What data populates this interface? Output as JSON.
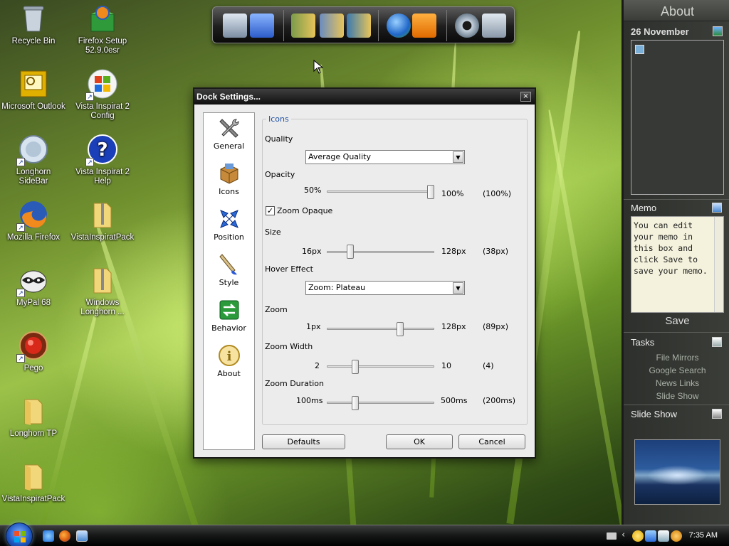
{
  "desktop_icons": [
    {
      "label": "Recycle Bin"
    },
    {
      "label": "Firefox Setup 52.9.0esr"
    },
    {
      "label": "Microsoft Outlook"
    },
    {
      "label": "Vista Inspirat 2 Config"
    },
    {
      "label": "Longhorn SideBar"
    },
    {
      "label": "Vista Inspirat 2 Help"
    },
    {
      "label": "Mozilla Firefox"
    },
    {
      "label": "VistaInspiratPack"
    },
    {
      "label": "MyPal 68"
    },
    {
      "label": "Windows Longhorn ..."
    },
    {
      "label": "Pego"
    },
    {
      "label": "Longhorn TP"
    },
    {
      "label": "VistaInspiratPack"
    }
  ],
  "sidebar": {
    "header": "About",
    "date": "26 November",
    "memo_title": "Memo",
    "memo_text": "You can edit your memo in this box and click Save to save your memo.",
    "save_label": "Save",
    "tasks_title": "Tasks",
    "tasks": [
      "File Mirrors",
      "Google Search",
      "News Links",
      "Slide Show"
    ],
    "slideshow_title": "Slide Show"
  },
  "dialog": {
    "title": "Dock Settings...",
    "close_glyph": "×",
    "nav": [
      "General",
      "Icons",
      "Position",
      "Style",
      "Behavior",
      "About"
    ],
    "group_title": "Icons",
    "quality_label": "Quality",
    "quality_value": "Average Quality",
    "opacity": {
      "label": "Opacity",
      "min": "50%",
      "max": "100%",
      "current": "(100%)",
      "value": 100,
      "range": [
        50,
        100
      ]
    },
    "zoom_opaque_label": "Zoom Opaque",
    "zoom_opaque_checked": true,
    "size": {
      "label": "Size",
      "min": "16px",
      "max": "128px",
      "current": "(38px)",
      "value": 38,
      "range": [
        16,
        128
      ]
    },
    "hover_label": "Hover Effect",
    "hover_value": "Zoom: Plateau",
    "zoom": {
      "label": "Zoom",
      "min": "1px",
      "max": "128px",
      "current": "(89px)",
      "value": 89,
      "range": [
        1,
        128
      ]
    },
    "zoom_width": {
      "label": "Zoom Width",
      "min": "2",
      "max": "10",
      "current": "(4)",
      "value": 4,
      "range": [
        2,
        10
      ]
    },
    "zoom_duration": {
      "label": "Zoom Duration",
      "min": "100ms",
      "max": "500ms",
      "current": "(200ms)",
      "value": 200,
      "range": [
        100,
        500
      ]
    },
    "buttons": {
      "defaults": "Defaults",
      "ok": "OK",
      "cancel": "Cancel"
    },
    "check_glyph": "✓",
    "arrow_glyph": "▼"
  },
  "taskbar": {
    "clock": "7:35 AM"
  }
}
